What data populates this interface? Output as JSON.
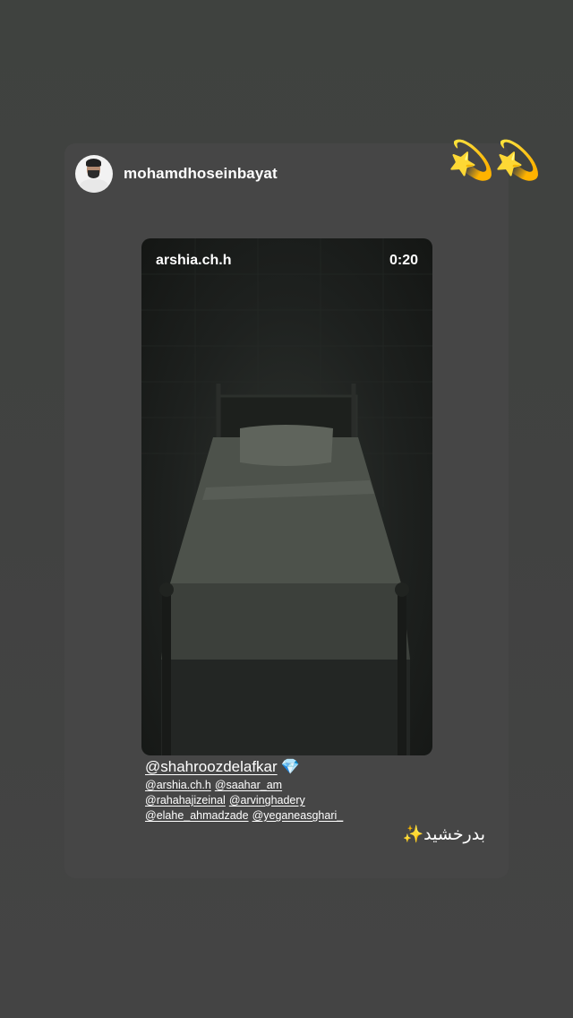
{
  "story": {
    "username": "mohamdhoseinbayat",
    "stickers": [
      "💫",
      "💫"
    ]
  },
  "video": {
    "username": "arshia.ch.h",
    "duration": "0:20"
  },
  "mentions": {
    "main": "@shahroozdelafkar",
    "main_emoji": "💎",
    "rows": [
      [
        "@arshia.ch.h",
        "@saahar_am"
      ],
      [
        "@rahahajizeinal",
        "@arvinghadery"
      ],
      [
        "@elahe_ahmadzade",
        "@yeganeasghari_"
      ]
    ]
  },
  "caption": "بدرخشید✨"
}
